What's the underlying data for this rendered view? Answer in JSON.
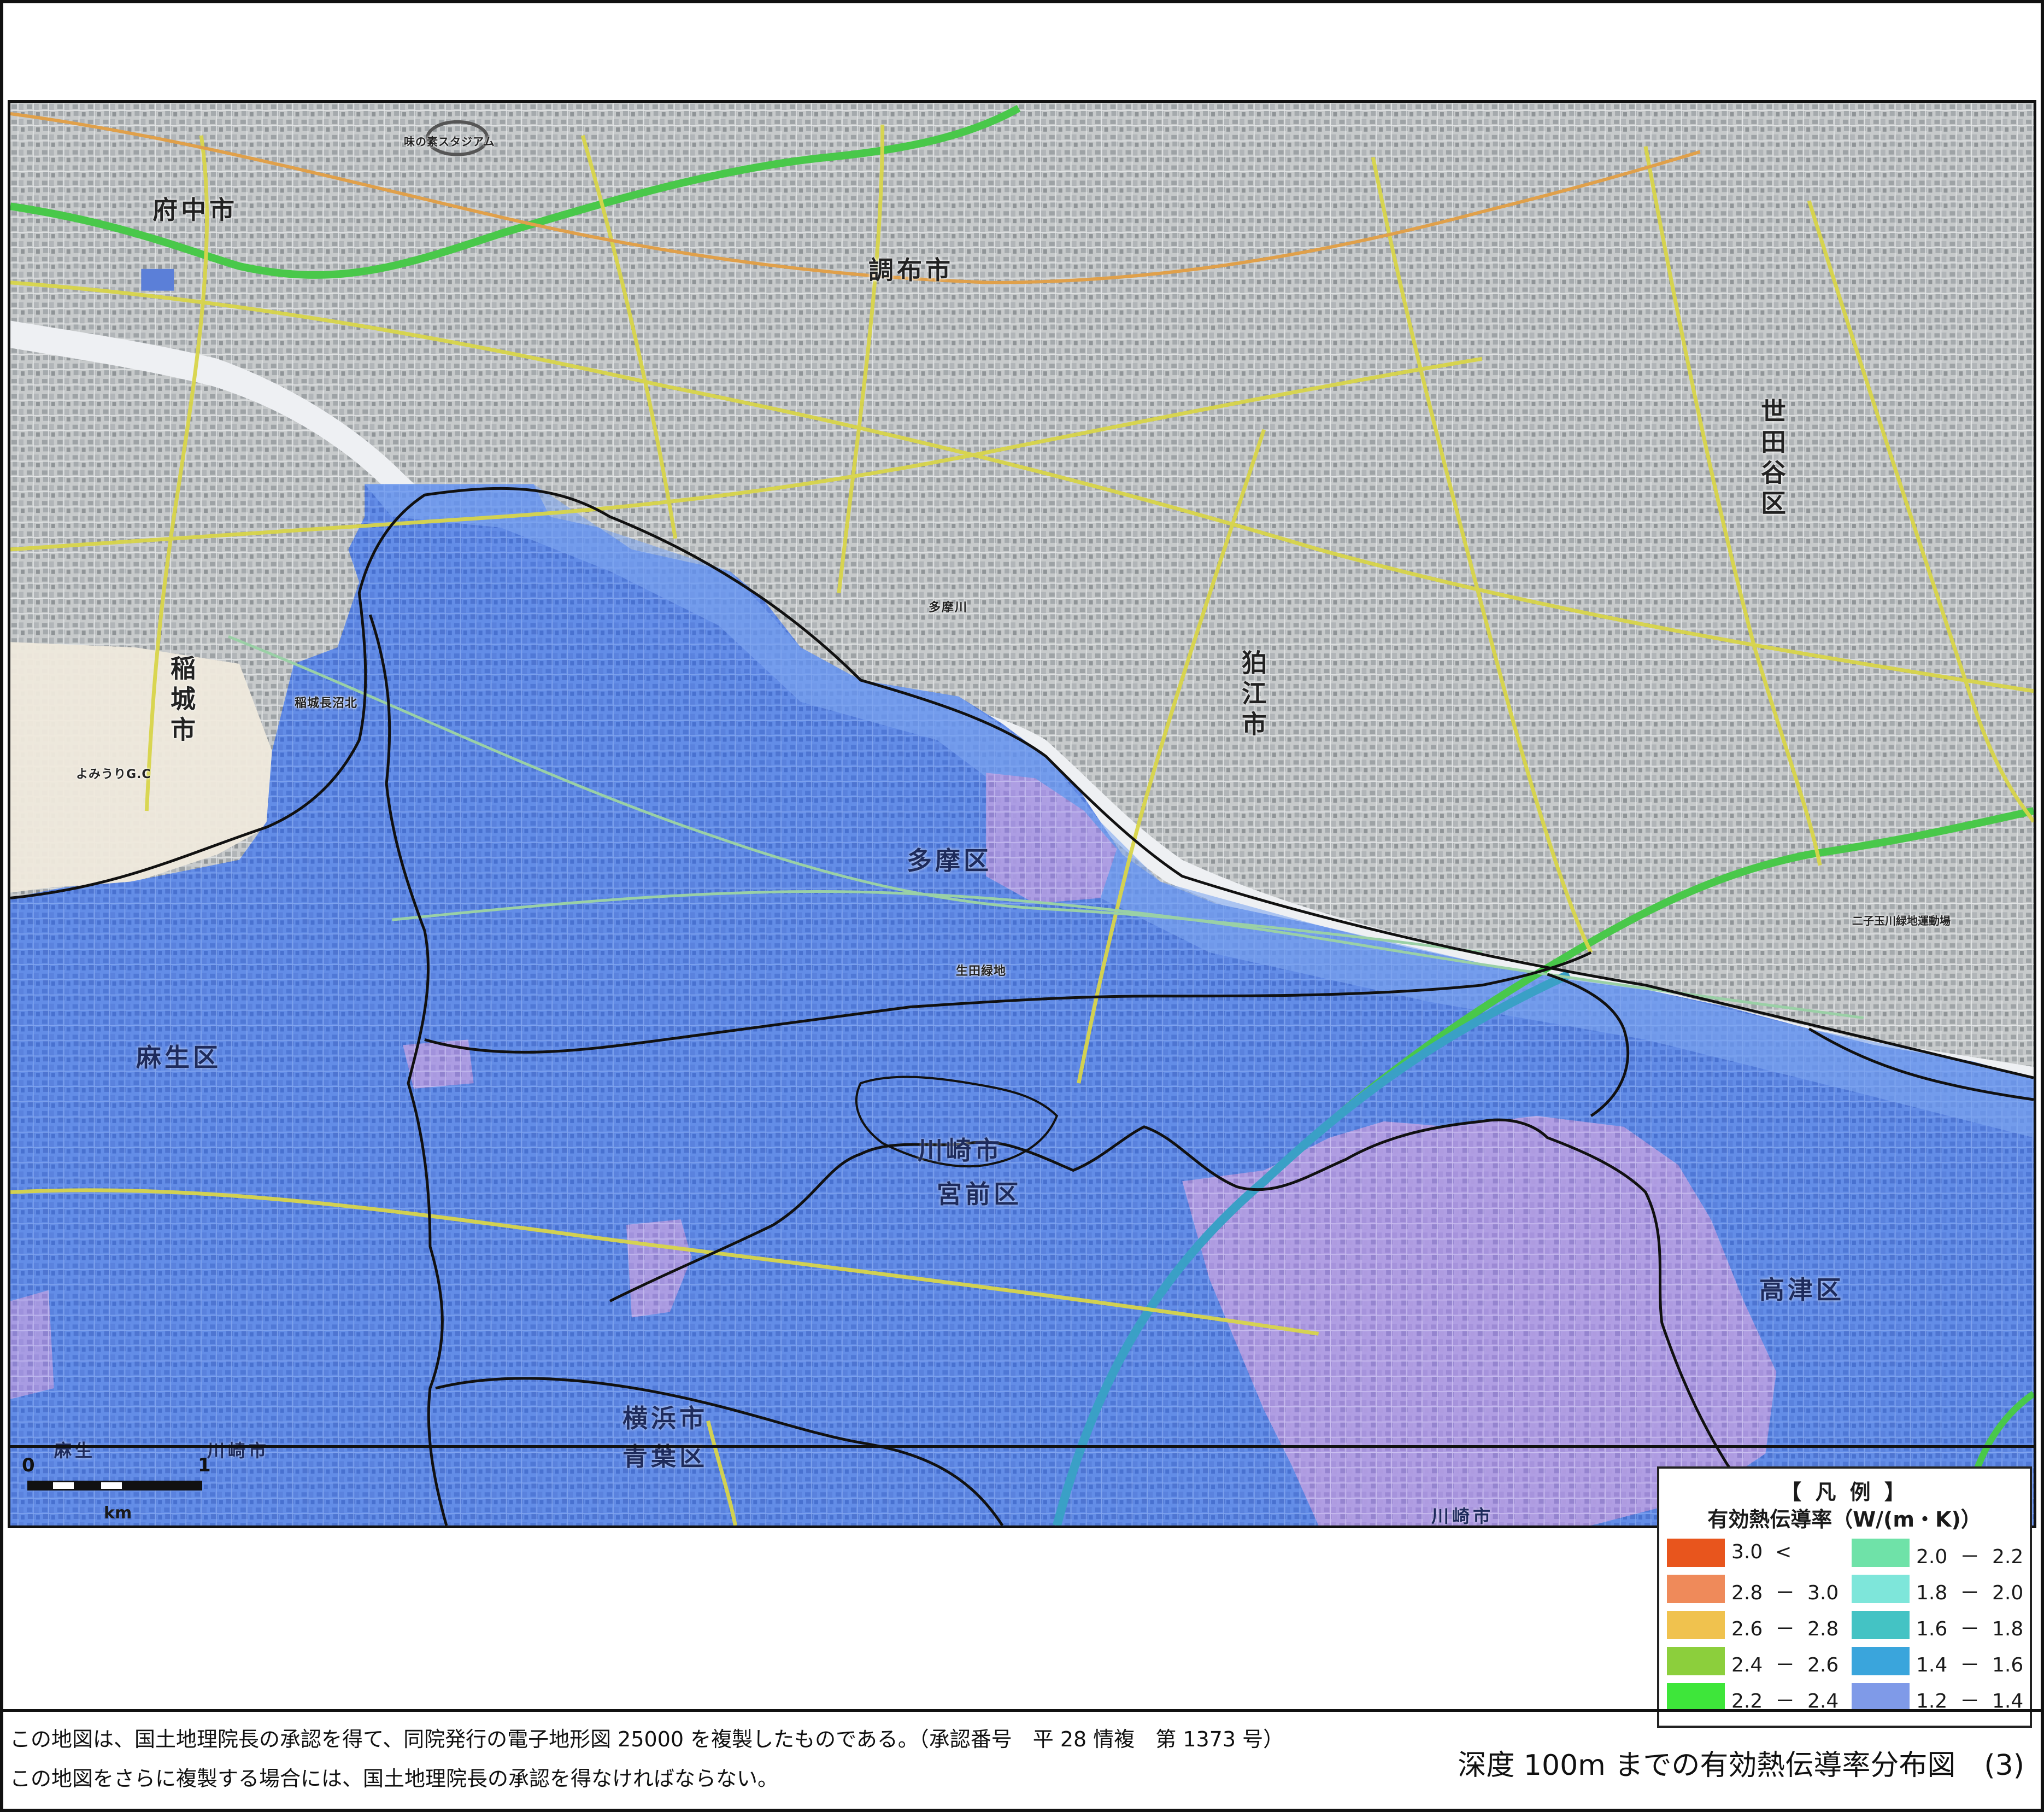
{
  "map": {
    "place_labels": {
      "fuchu": "府中市",
      "chofu": "調布市",
      "setagaya": "世田谷区",
      "komae": "狛江市",
      "inagi": "稲城市",
      "tama": "多摩区",
      "asao": "麻生区",
      "kawasaki_city": "川崎市",
      "miyamae": "宮前区",
      "takatsu": "高津区",
      "yokohama_city": "横浜市",
      "aoba": "青葉区",
      "asao_bottom": "麻生",
      "kawasaki_bottom_left": "川崎市",
      "kawasaki_bottom_right": "川崎市"
    },
    "feature_labels": {
      "river_tama": "多摩川",
      "stadium": "味の素スタジアム",
      "golf": "よみうりG.C",
      "inagi_park": "稲城長沼北",
      "ikuta_ryokuchi": "生田緑地",
      "futako_park": "二子玉川緑地運動場"
    },
    "colors": {
      "base_map": "#c3c6c7",
      "overlay_blue": "#5a86e6",
      "overlay_light": "#7aa3ef",
      "overlay_pink": "#c7a0e0",
      "river": "#eef0f3",
      "expressway": "#49c84a",
      "main_road": "#d8d54a",
      "rail": "#e0a04a",
      "boundary": "#111111"
    }
  },
  "scale_bar": {
    "start_label": "0",
    "end_label": "1",
    "unit": "km"
  },
  "legend": {
    "title": "【 凡 例 】",
    "subtitle": "有効熱伝導率（W/(m・K)）",
    "items": [
      {
        "label": "3.0  <",
        "color": "#e8551d"
      },
      {
        "label": "2.8  －  3.0",
        "color": "#ef8a5a"
      },
      {
        "label": "2.6  －  2.8",
        "color": "#f0c24e"
      },
      {
        "label": "2.4  －  2.6",
        "color": "#8ccf3c"
      },
      {
        "label": "2.2  －  2.4",
        "color": "#3ee63a"
      },
      {
        "label": "2.0  －  2.2",
        "color": "#6fe2a8"
      },
      {
        "label": "1.8  －  2.0",
        "color": "#7ee6da"
      },
      {
        "label": "1.6  －  1.8",
        "color": "#44c3c4"
      },
      {
        "label": "1.4  －  1.6",
        "color": "#3aa5dc"
      },
      {
        "label": "1.2  －  1.4",
        "color": "#7f9ae8"
      }
    ]
  },
  "footer": {
    "note_line1": "この地図は、国土地理院長の承認を得て、同院発行の電子地形図 25000 を複製したものである。（承認番号　平 28 情複　第 1373 号）",
    "note_line2": "この地図をさらに複製する場合には、国土地理院長の承認を得なければならない。",
    "map_title": "深度 100m までの有効熱伝導率分布図　(3)"
  }
}
